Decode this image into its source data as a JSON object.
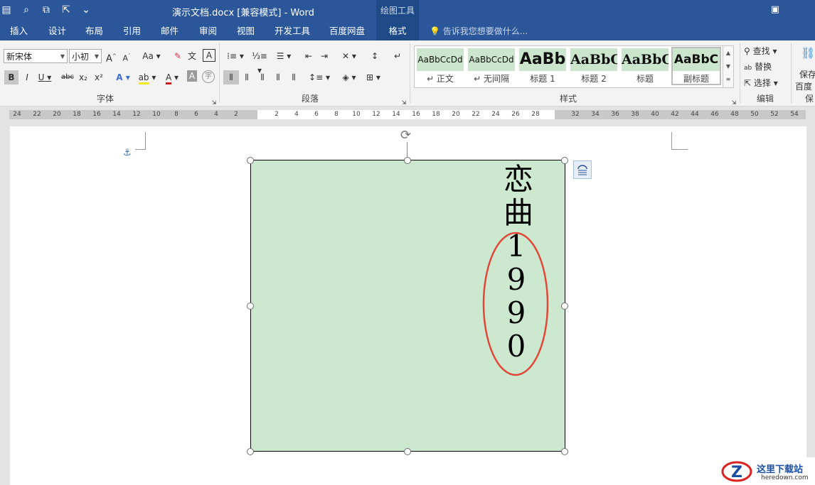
{
  "titlebar": {
    "document_title": "演示文档.docx [兼容模式] - Word",
    "contextual_tab_group": "绘图工具"
  },
  "tabs": [
    "插入",
    "设计",
    "布局",
    "引用",
    "邮件",
    "审阅",
    "视图",
    "开发工具",
    "百度网盘",
    "格式"
  ],
  "active_tab": "格式",
  "tell_me": "告诉我您想要做什么...",
  "font_group": {
    "label": "字体",
    "font_name": "新宋体",
    "font_size": "小初",
    "grow": "A",
    "shrink": "A",
    "change_case": "Aa",
    "bold": "B",
    "italic": "I",
    "underline": "U",
    "strike": "abc",
    "subscript": "x₂",
    "superscript": "x²",
    "highlight": "ab",
    "font_color": "A",
    "char_shading": "A",
    "phonetic": "文",
    "enclose": "字"
  },
  "paragraph_group": {
    "label": "段落"
  },
  "styles_group": {
    "label": "样式",
    "items": [
      {
        "sample": "AaBbCcDd",
        "name": "↵ 正文"
      },
      {
        "sample": "AaBbCcDd",
        "name": "↵ 无间隔"
      },
      {
        "sample": "AaBb",
        "name": "标题 1"
      },
      {
        "sample": "AaBbC",
        "name": "标题 2"
      },
      {
        "sample": "AaBbC",
        "name": "标题"
      },
      {
        "sample": "AaBbC",
        "name": "副标题"
      }
    ]
  },
  "editing_group": {
    "label": "编辑",
    "find": "查找",
    "replace": "替换",
    "select": "选择"
  },
  "save_group": {
    "save_label_1": "保存",
    "save_label_2": "百度",
    "group_label": "保"
  },
  "ruler": {
    "left_ticks": [
      "24",
      "22",
      "20",
      "18",
      "16",
      "14",
      "12",
      "10",
      "8",
      "6",
      "4",
      "2"
    ],
    "mid_ticks": [
      "2",
      "4",
      "6",
      "8",
      "10",
      "12",
      "14",
      "16",
      "18",
      "20",
      "22",
      "24",
      "26",
      "28"
    ],
    "right_ticks": [
      "32",
      "34",
      "36",
      "38",
      "40",
      "42",
      "44",
      "46",
      "48",
      "50",
      "52",
      "54"
    ]
  },
  "shape_text": [
    "恋",
    "曲",
    "1",
    "9",
    "9",
    "0"
  ],
  "colors": {
    "title_bar": "#2b579a",
    "shape_fill": "#cce8cf",
    "annotation_ellipse": "#e0483a"
  },
  "icons": {
    "anchor": "⚓",
    "rotate": "⟳"
  },
  "watermark": {
    "site_name": "这里下载站",
    "url": "heredown.com"
  }
}
